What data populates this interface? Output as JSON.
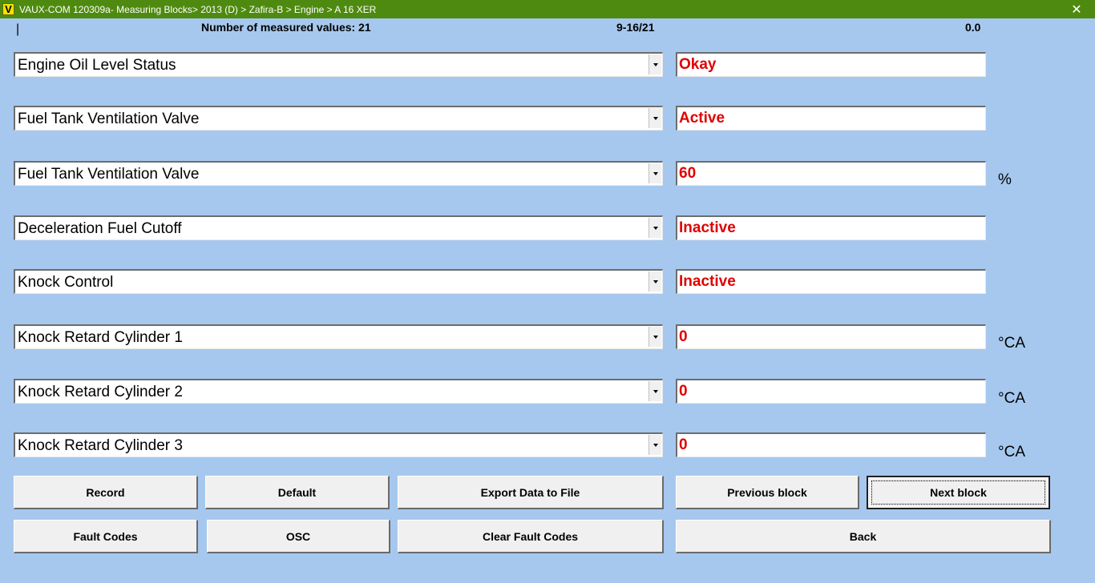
{
  "window": {
    "icon_letter": "V",
    "title": "VAUX-COM 120309a- Measuring Blocks> 2013 (D) > Zafira-B > Engine > A 16 XER",
    "close_glyph": "✕"
  },
  "header": {
    "cursor_glyph": "|",
    "measured_count_text": "Number of measured values: 21",
    "range_text": "9-16/21",
    "value_text": "0.0"
  },
  "rows": [
    {
      "label": "Engine Oil Level Status",
      "value": "Okay",
      "unit": ""
    },
    {
      "label": "Fuel Tank Ventilation Valve",
      "value": "Active",
      "unit": ""
    },
    {
      "label": "Fuel Tank Ventilation Valve",
      "value": "60",
      "unit": "%"
    },
    {
      "label": "Deceleration Fuel Cutoff",
      "value": "Inactive",
      "unit": ""
    },
    {
      "label": "Knock Control",
      "value": "Inactive",
      "unit": ""
    },
    {
      "label": "Knock Retard Cylinder 1",
      "value": "0",
      "unit": "°CA"
    },
    {
      "label": "Knock Retard Cylinder 2",
      "value": "0",
      "unit": "°CA"
    },
    {
      "label": "Knock Retard Cylinder 3",
      "value": "0",
      "unit": "°CA"
    }
  ],
  "buttons": {
    "record": "Record",
    "default": "Default",
    "export": "Export Data to File",
    "previous_block": "Previous block",
    "next_block": "Next block",
    "fault_codes": "Fault Codes",
    "osc": "OSC",
    "clear_fault_codes": "Clear Fault Codes",
    "back": "Back"
  },
  "colors": {
    "background": "#a6c8ee",
    "titlebar": "#4f8a10",
    "value_text": "#e00000"
  }
}
